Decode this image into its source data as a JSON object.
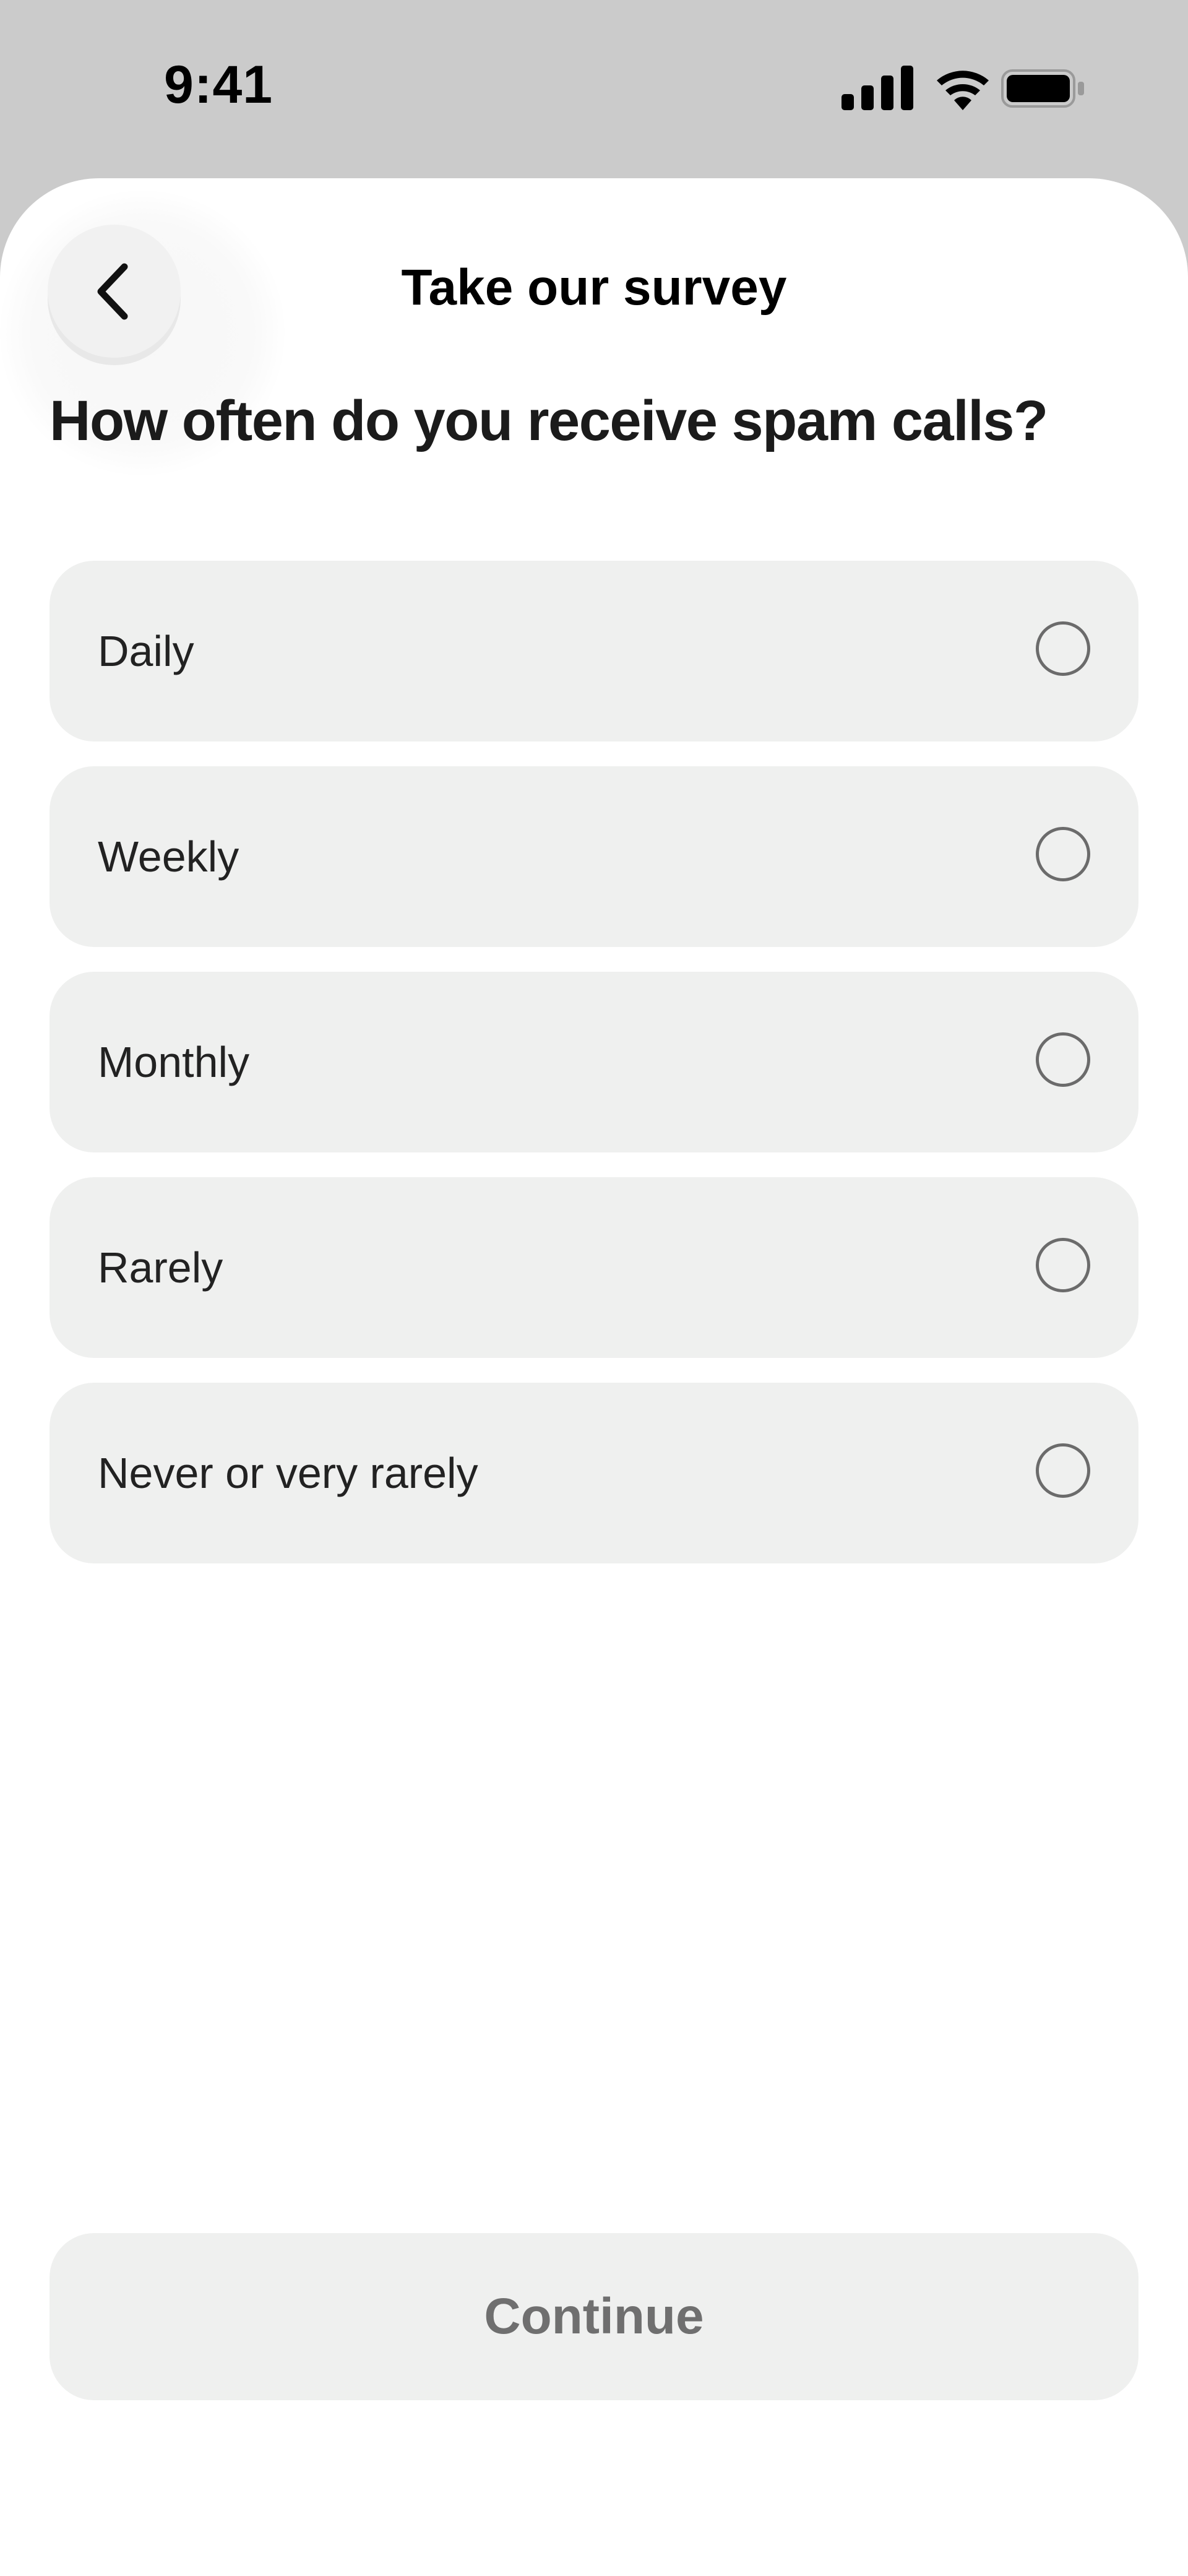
{
  "status_bar": {
    "time": "9:41",
    "icons": [
      "cellular-signal-icon",
      "wifi-icon",
      "battery-icon"
    ]
  },
  "header": {
    "back_icon": "chevron-left-icon",
    "title": "Take our survey"
  },
  "question": "How often do you receive spam calls?",
  "options": [
    {
      "label": "Daily",
      "selected": false
    },
    {
      "label": "Weekly",
      "selected": false
    },
    {
      "label": "Monthly",
      "selected": false
    },
    {
      "label": "Rarely",
      "selected": false
    },
    {
      "label": "Never or very rarely",
      "selected": false
    }
  ],
  "continue_label": "Continue",
  "colors": {
    "status_bar_bg": "#cbcbcb",
    "sheet_bg": "#ffffff",
    "option_bg": "#eff0ef",
    "radio_border": "#6b6b6b",
    "continue_text": "#6f6f6f"
  }
}
